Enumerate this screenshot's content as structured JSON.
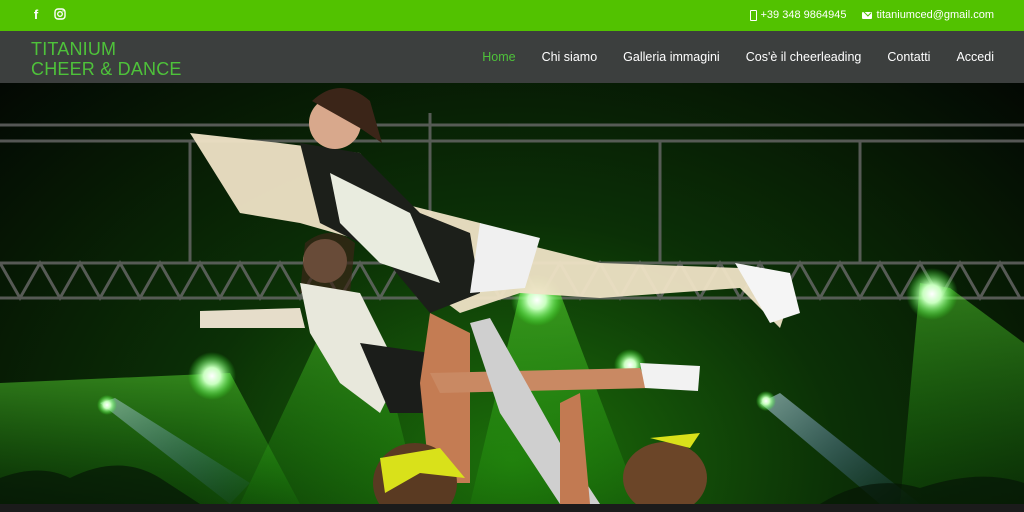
{
  "topbar": {
    "social_icons": [
      "facebook-icon",
      "instagram-icon"
    ],
    "phone": "+39 348 9864945",
    "email": "titaniumced@gmail.com",
    "background": "#52c200"
  },
  "brand": {
    "line1": "TITANIUM",
    "line2": "CHEER & DANCE",
    "color": "#4ec23a"
  },
  "nav": {
    "items": [
      {
        "label": "Home",
        "active": true
      },
      {
        "label": "Chi siamo"
      },
      {
        "label": "Galleria immagini"
      },
      {
        "label": "Cos'è il cheerleading"
      },
      {
        "label": "Contatti"
      },
      {
        "label": "Accedi"
      }
    ],
    "background": "#3c3f3e"
  },
  "hero": {
    "description_icon": "cheerleaders-stage-photo"
  }
}
